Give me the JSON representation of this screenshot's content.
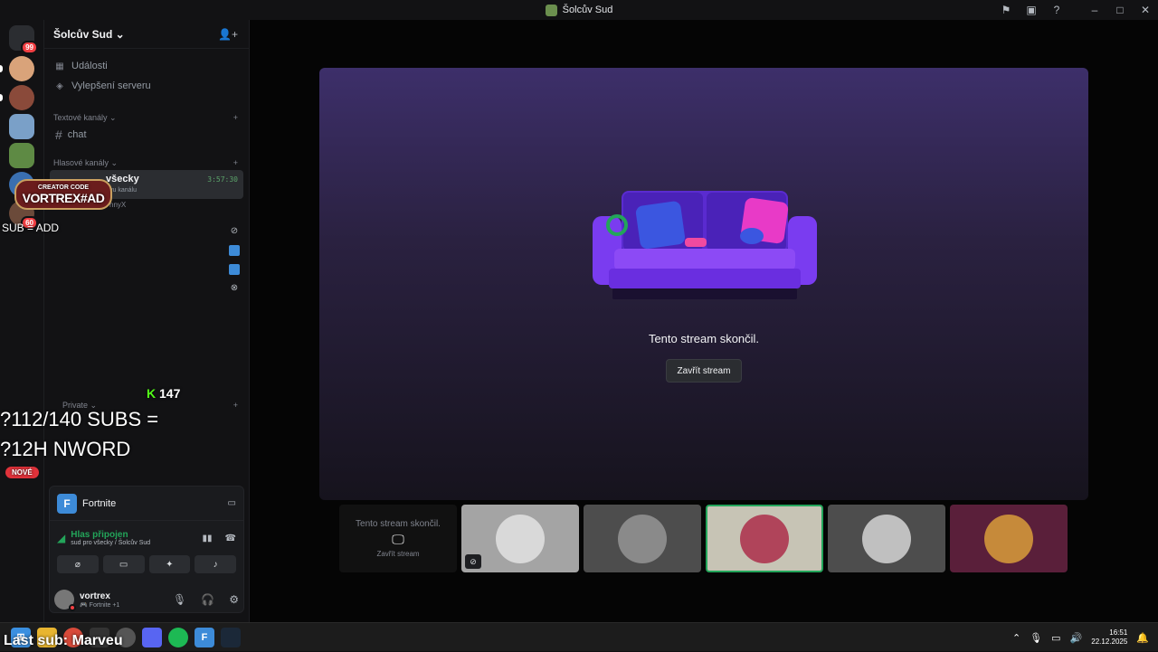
{
  "window": {
    "title": "Šolcův Sud",
    "controls": [
      "flag-icon",
      "inbox-icon",
      "help-icon",
      "minimize",
      "maximize",
      "close"
    ]
  },
  "guild_badges": {
    "home_badge": "99",
    "badge_60": "60"
  },
  "sidebar": {
    "server_name": "Šolcův Sud",
    "menu": {
      "events": "Události",
      "boost": "Vylepšení serveru"
    },
    "text_category": "Textové kanály",
    "text_channels": [
      "chat"
    ],
    "voice_category": "Hlasové kanály",
    "voice_channel": {
      "name_partial": "všecky",
      "time": "3:57:30",
      "sub_partial": "vu kanálu",
      "member_partial": "nnyX"
    },
    "private_category": "Private"
  },
  "activity": {
    "game": "Fortnite",
    "game_initial": "F",
    "voice_status": "Hlas připojen",
    "voice_location": "sud pro všecky / Šolcův Sud"
  },
  "user": {
    "name": "vortrex",
    "status": "Fortnite +1"
  },
  "stage": {
    "ended_text": "Tento stream skončil.",
    "close_button": "Zavřít stream"
  },
  "thumbnails": {
    "ended_title": "Tento stream skončil.",
    "ended_button": "Zavřít stream"
  },
  "overlays": {
    "creator_line1": "CREATOR CODE",
    "creator_line2": "VORTREX#AD",
    "sub_add": "SUB = ADD",
    "kick_count": "147",
    "subs_goal": "?112/140 SUBS =",
    "subs_reward": "?12H NWORD",
    "last_sub": "Last sub: Marveu",
    "nove_badge": "NOVÉ"
  },
  "taskbar": {
    "time": "16:51",
    "date": "22.12.2025"
  },
  "colors": {
    "accent_green": "#23a55a",
    "mention_red": "#f23f43",
    "fortnite_blue": "#3d8bd8"
  }
}
